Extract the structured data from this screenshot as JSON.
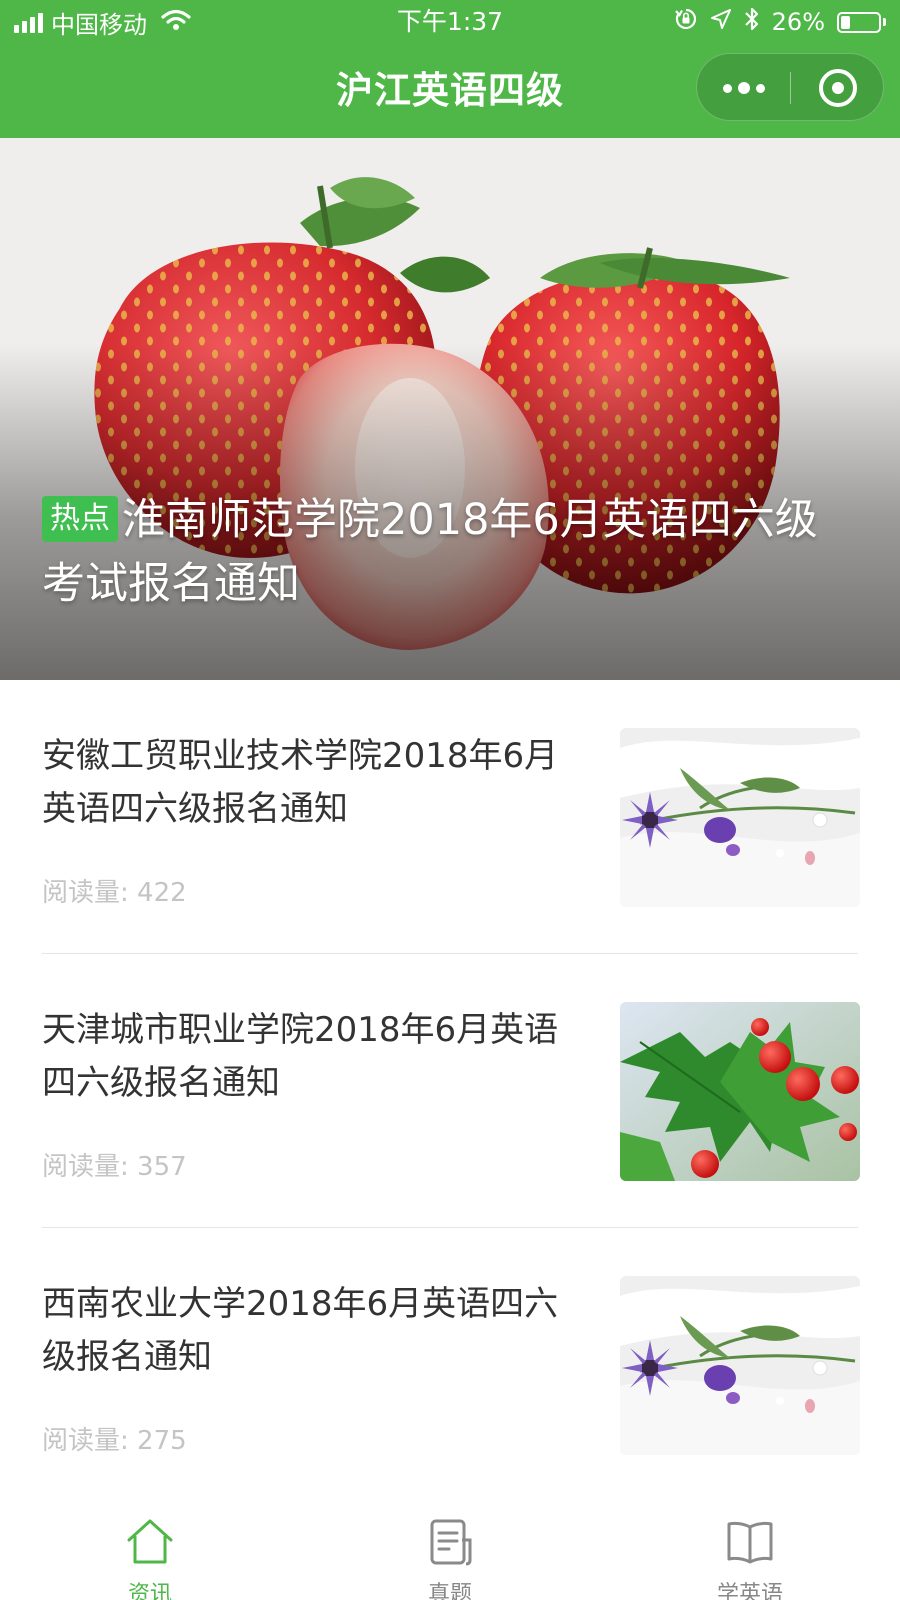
{
  "status_bar": {
    "carrier": "中国移动",
    "time": "下午1:37",
    "battery": "26%",
    "battery_level": 0.26
  },
  "nav": {
    "title": "沪江英语四级",
    "icons": [
      "more-dots-icon",
      "close-miniprogram-icon"
    ]
  },
  "banner": {
    "tag": "热点",
    "title": "淮南师范学院2018年6月英语四六级考试报名通知",
    "image": "strawberries-photo"
  },
  "articles": [
    {
      "title": "安徽工贸职业技术学院2018年6月英语四六级报名通知",
      "reads_label": "阅读量: 422",
      "image": "wildflowers-photo"
    },
    {
      "title": "天津城市职业学院2018年6月英语四六级报名通知",
      "reads_label": "阅读量: 357",
      "image": "holly-berries-photo"
    },
    {
      "title": "西南农业大学2018年6月英语四六级报名通知",
      "reads_label": "阅读量: 275",
      "image": "wildflowers-photo"
    }
  ],
  "tabs": [
    {
      "label": "资讯",
      "icon": "home-icon",
      "active": true
    },
    {
      "label": "真题",
      "icon": "exam-paper-icon",
      "active": false
    },
    {
      "label": "学英语",
      "icon": "book-icon",
      "active": false
    }
  ],
  "colors": {
    "brand_green": "#4eb748",
    "tag_green": "#3fbf50",
    "muted_text": "#c4c4c4"
  }
}
